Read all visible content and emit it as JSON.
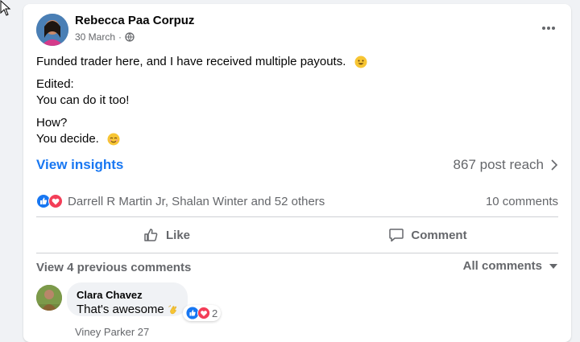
{
  "post": {
    "author": "Rebecca Paa Corpuz",
    "date": "30 March",
    "privacy_icon": "public-globe-icon",
    "paragraphs": [
      "Funded trader here, and I have received multiple payouts.",
      "Edited:",
      "You can do it too!",
      "How?",
      "You decide."
    ]
  },
  "insights": {
    "link_label": "View insights",
    "reach": "867 post reach"
  },
  "reactions": {
    "names": "Darrell R Martin Jr, Shalan Winter and 52 others",
    "comments_count": "10 comments"
  },
  "actions": {
    "like": "Like",
    "comment": "Comment"
  },
  "comments_section": {
    "previous": "View 4 previous comments",
    "filter": "All comments",
    "comment": {
      "author": "Clara Chavez",
      "text": "That's awesome",
      "reaction_count": "2"
    },
    "next_author_partial": "Viney Parker 27"
  },
  "colors": {
    "accent": "#1877f2",
    "love": "#f33e58",
    "muted": "#65676b"
  }
}
